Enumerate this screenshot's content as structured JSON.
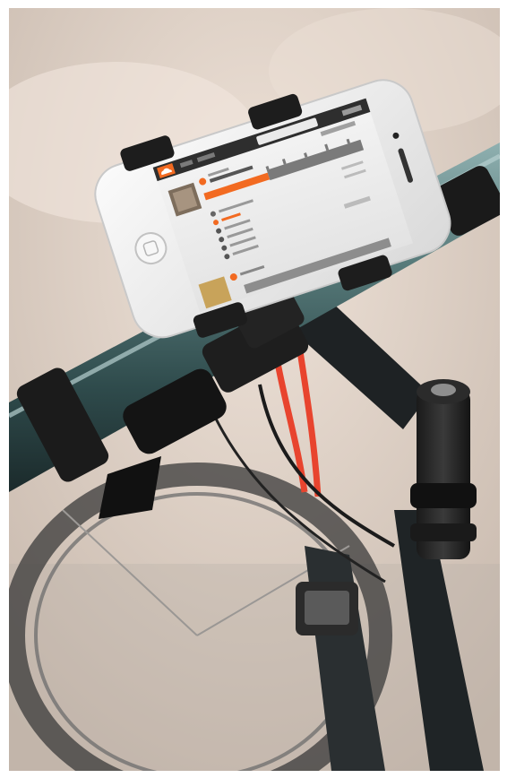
{
  "scene": {
    "description_free_labels": [],
    "phone": {
      "app": {
        "logo_icon": "cloud-icon",
        "accent_color": "#f26a21",
        "nav_tabs": [
          "",
          ""
        ],
        "search_placeholder": "",
        "track_list": []
      }
    },
    "colors": {
      "background_top": "#e6d9cf",
      "background_bottom": "#bcb0a6",
      "handlebar": "#4a6a6b",
      "phone_body": "#f2f2f2",
      "mount_black": "#1e1e1e",
      "cable_red": "#e8442e"
    }
  }
}
